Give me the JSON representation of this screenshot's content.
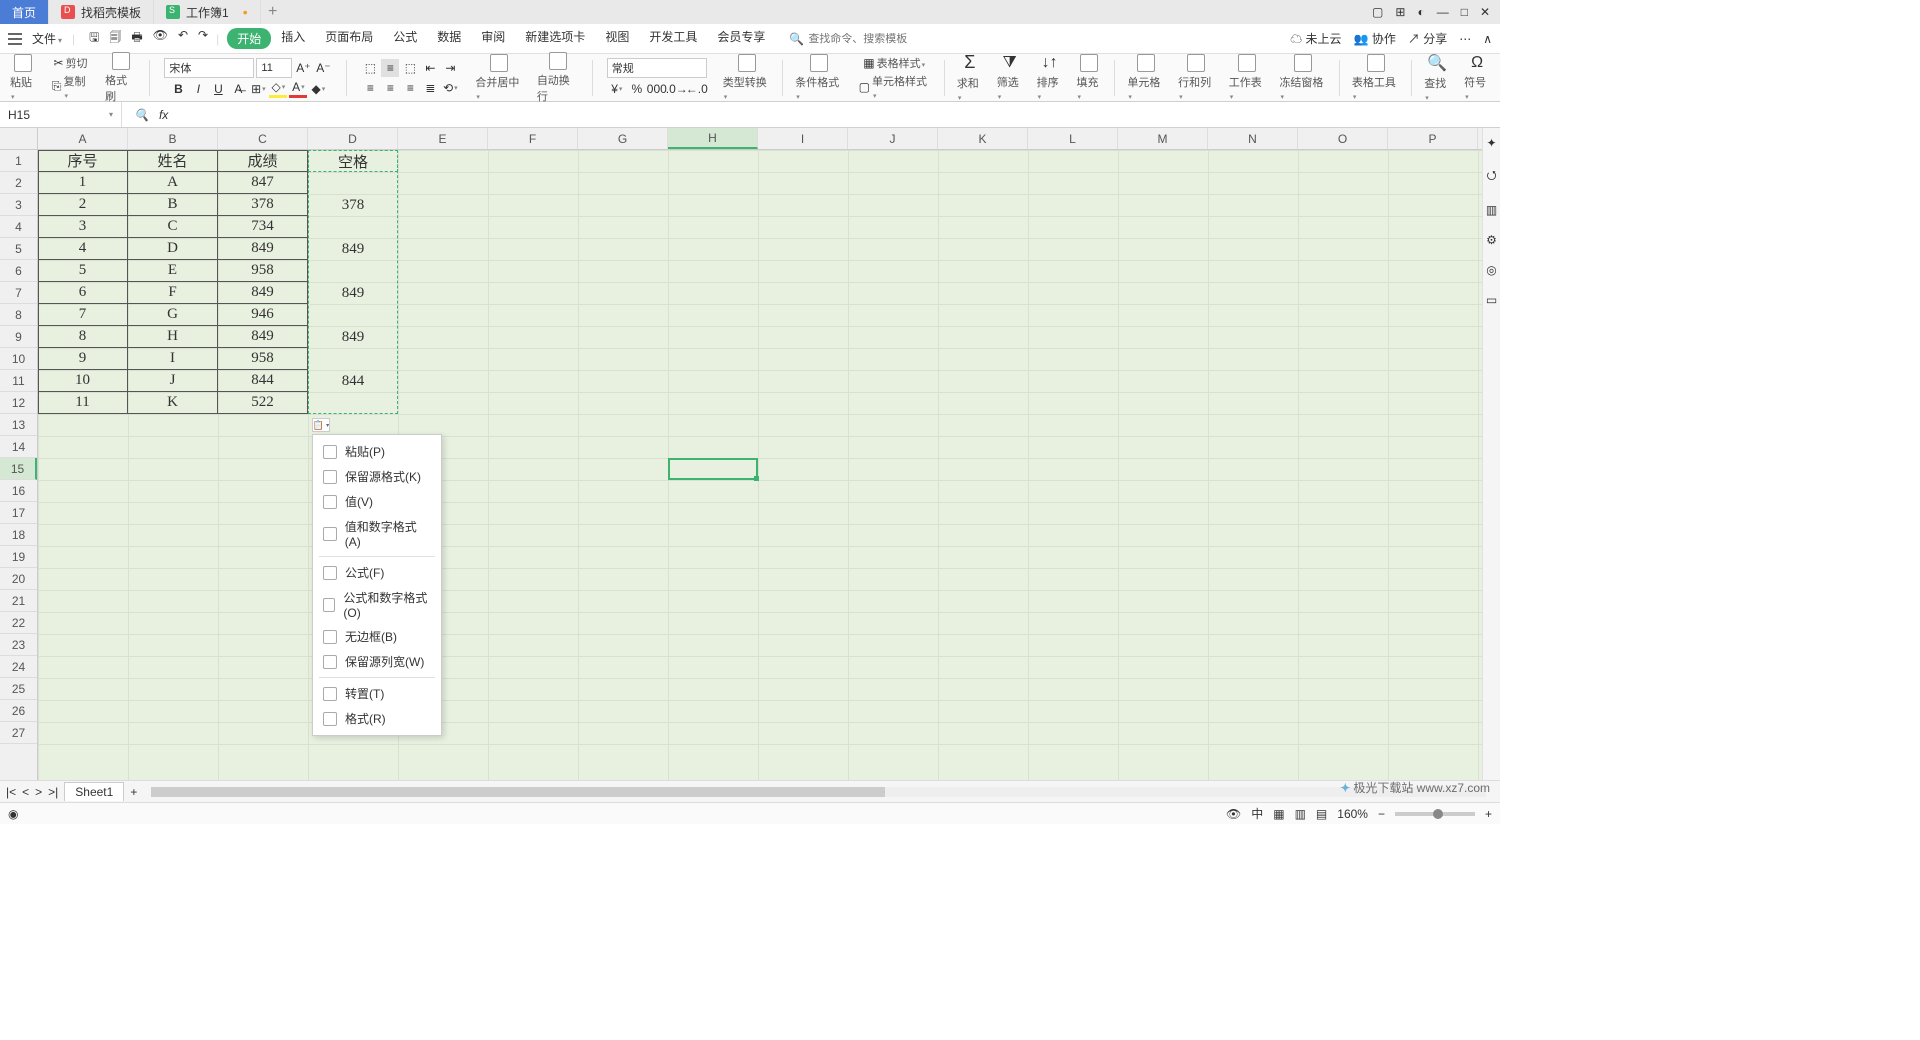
{
  "tabs": {
    "home": "首页",
    "docer": "找稻壳模板",
    "workbook": "工作簿1"
  },
  "menu": {
    "file": "文件",
    "tabs": [
      "开始",
      "插入",
      "页面布局",
      "公式",
      "数据",
      "审阅",
      "新建选项卡",
      "视图",
      "开发工具",
      "会员专享"
    ],
    "search_ph": "查找命令、搜索模板"
  },
  "menu_right": {
    "cloud": "未上云",
    "coop": "协作",
    "share": "分享"
  },
  "ribbon": {
    "paste": "粘贴",
    "cut": "剪切",
    "copy": "复制",
    "fmtpaint": "格式刷",
    "font": "宋体",
    "size": "11",
    "merge": "合并居中",
    "wrap": "自动换行",
    "numfmt": "常规",
    "typeconv": "类型转换",
    "condfmt": "条件格式",
    "tblstyle": "表格样式",
    "cellstyle": "单元格样式",
    "sum": "求和",
    "filter": "筛选",
    "sort": "排序",
    "fill": "填充",
    "cell": "单元格",
    "rowcol": "行和列",
    "sheet": "工作表",
    "freeze": "冻结窗格",
    "tbltool": "表格工具",
    "find": "查找",
    "symbol": "符号"
  },
  "namebox": "H15",
  "columns": [
    "A",
    "B",
    "C",
    "D",
    "E",
    "F",
    "G",
    "H",
    "I",
    "J",
    "K",
    "L",
    "M",
    "N",
    "O",
    "P"
  ],
  "rows": 27,
  "active": {
    "col": "H",
    "row": 15
  },
  "table": {
    "headers": [
      "序号",
      "姓名",
      "成绩",
      "空格"
    ],
    "data": [
      [
        "1",
        "A",
        "847",
        ""
      ],
      [
        "2",
        "B",
        "378",
        "378"
      ],
      [
        "3",
        "C",
        "734",
        ""
      ],
      [
        "4",
        "D",
        "849",
        "849"
      ],
      [
        "5",
        "E",
        "958",
        ""
      ],
      [
        "6",
        "F",
        "849",
        "849"
      ],
      [
        "7",
        "G",
        "946",
        ""
      ],
      [
        "8",
        "H",
        "849",
        "849"
      ],
      [
        "9",
        "I",
        "958",
        ""
      ],
      [
        "10",
        "J",
        "844",
        "844"
      ],
      [
        "11",
        "K",
        "522",
        ""
      ]
    ]
  },
  "chart_data": {
    "type": "table",
    "title": "",
    "columns": [
      "序号",
      "姓名",
      "成绩",
      "空格"
    ],
    "rows": [
      [
        1,
        "A",
        847,
        null
      ],
      [
        2,
        "B",
        378,
        378
      ],
      [
        3,
        "C",
        734,
        null
      ],
      [
        4,
        "D",
        849,
        849
      ],
      [
        5,
        "E",
        958,
        null
      ],
      [
        6,
        "F",
        849,
        849
      ],
      [
        7,
        "G",
        946,
        null
      ],
      [
        8,
        "H",
        849,
        849
      ],
      [
        9,
        "I",
        958,
        null
      ],
      [
        10,
        "J",
        844,
        844
      ],
      [
        11,
        "K",
        522,
        null
      ]
    ]
  },
  "ctx": [
    "粘贴(P)",
    "保留源格式(K)",
    "值(V)",
    "值和数字格式(A)",
    "-",
    "公式(F)",
    "公式和数字格式(O)",
    "无边框(B)",
    "保留源列宽(W)",
    "-",
    "转置(T)",
    "格式(R)"
  ],
  "sheettab": "Sheet1",
  "status": {
    "zoom": "160%",
    "ime": "中"
  },
  "watermark": "极光下载站 www.xz7.com"
}
